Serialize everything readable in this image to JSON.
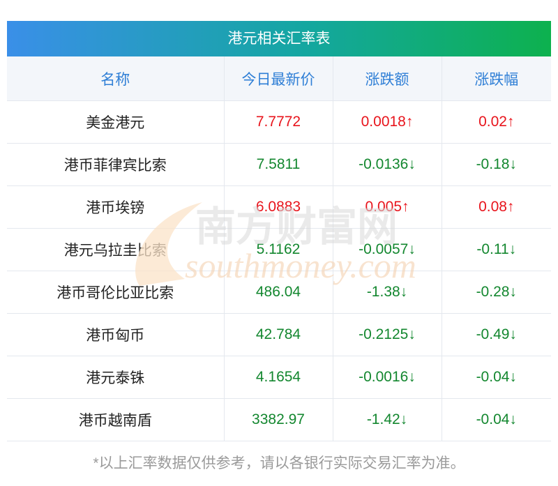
{
  "title": "港元相关汇率表",
  "headers": [
    "名称",
    "今日最新价",
    "涨跌额",
    "涨跌幅"
  ],
  "rows": [
    {
      "name": "美金港元",
      "price": "7.7772",
      "change": "0.0018↑",
      "pct": "0.02↑",
      "dir": "up"
    },
    {
      "name": "港币菲律宾比索",
      "price": "7.5811",
      "change": "-0.0136↓",
      "pct": "-0.18↓",
      "dir": "down"
    },
    {
      "name": "港币埃镑",
      "price": "6.0883",
      "change": "0.005↑",
      "pct": "0.08↑",
      "dir": "up"
    },
    {
      "name": "港元乌拉圭比索",
      "price": "5.1162",
      "change": "-0.0057↓",
      "pct": "-0.11↓",
      "dir": "down"
    },
    {
      "name": "港币哥伦比亚比索",
      "price": "486.04",
      "change": "-1.38↓",
      "pct": "-0.28↓",
      "dir": "down"
    },
    {
      "name": "港币匈币",
      "price": "42.784",
      "change": "-0.2125↓",
      "pct": "-0.49↓",
      "dir": "down"
    },
    {
      "name": "港元泰铢",
      "price": "4.1654",
      "change": "-0.0016↓",
      "pct": "-0.04↓",
      "dir": "down"
    },
    {
      "name": "港币越南盾",
      "price": "3382.97",
      "change": "-1.42↓",
      "pct": "-0.04↓",
      "dir": "down"
    }
  ],
  "watermark": {
    "cn": "南方财富网",
    "en": "southmoney.com"
  },
  "footnote": "*以上汇率数据仅供参考，请以各银行实际交易汇率为准。",
  "colors": {
    "up": "#e8141c",
    "down": "#13872f",
    "header_text": "#2f7fd6"
  }
}
